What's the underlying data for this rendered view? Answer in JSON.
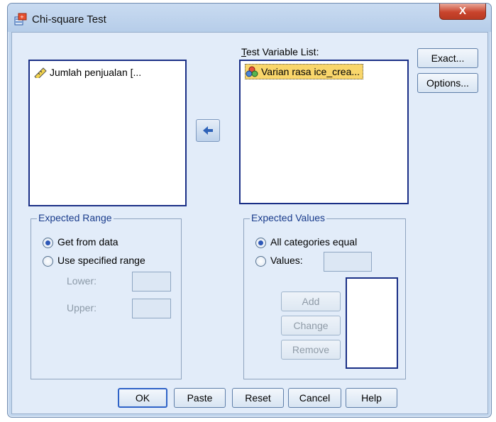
{
  "window": {
    "title": "Chi-square Test",
    "close_label": "X"
  },
  "source_list": {
    "items": [
      {
        "label": "Jumlah penjualan  [...",
        "icon": "ruler-scale-icon"
      }
    ]
  },
  "test_variable": {
    "label": "Test Variable List:",
    "items": [
      {
        "label": "Varian rasa ice_crea...",
        "icon": "nominal-variable-icon"
      }
    ]
  },
  "side_buttons": {
    "exact": "Exact...",
    "options": "Options..."
  },
  "expected_range": {
    "title": "Expected Range",
    "get_from_data": "Get from data",
    "use_specified": "Use specified range",
    "lower_label": "Lower:",
    "upper_label": "Upper:",
    "lower_value": "",
    "upper_value": ""
  },
  "expected_values": {
    "title": "Expected Values",
    "all_equal": "All categories equal",
    "values_label": "Values:",
    "values_value": "",
    "add": "Add",
    "change": "Change",
    "remove": "Remove"
  },
  "bottom_buttons": {
    "ok": "OK",
    "paste": "Paste",
    "reset": "Reset",
    "cancel": "Cancel",
    "help": "Help"
  },
  "colors": {
    "selection": "#f9d66b",
    "list_border": "#1a2f86",
    "group_title": "#1a3c8c",
    "close": "#c9442d"
  }
}
